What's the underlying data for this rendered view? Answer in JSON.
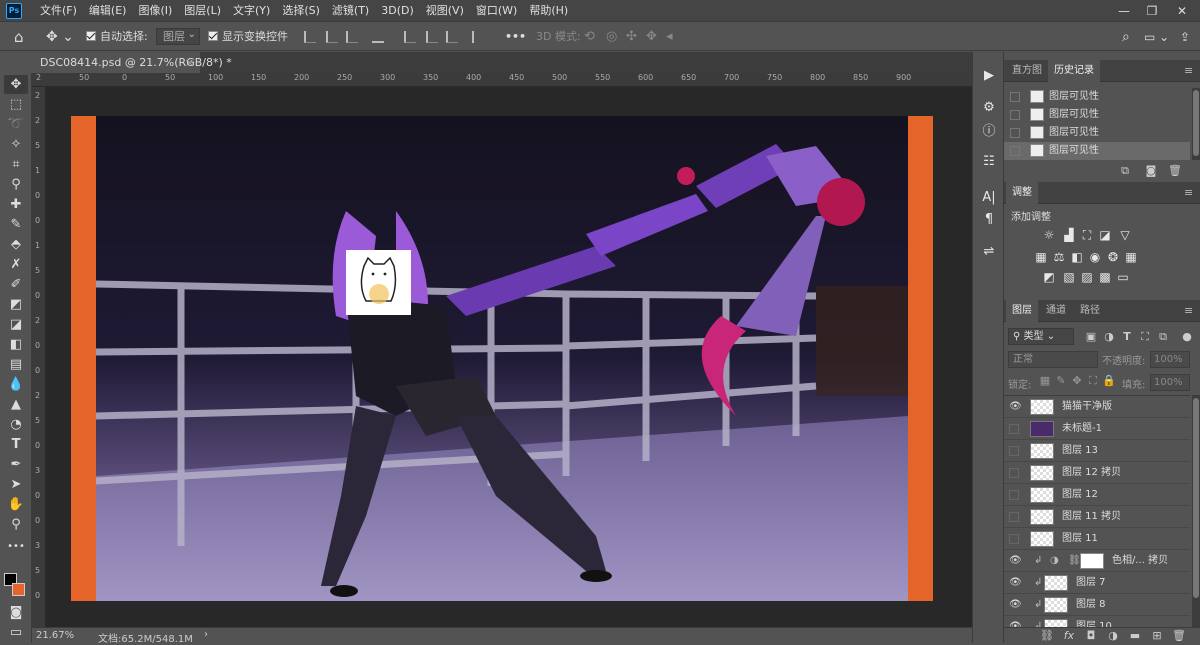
{
  "menubar": {
    "logo": "Ps",
    "items": [
      "文件(F)",
      "编辑(E)",
      "图像(I)",
      "图层(L)",
      "文字(Y)",
      "选择(S)",
      "滤镜(T)",
      "3D(D)",
      "视图(V)",
      "窗口(W)",
      "帮助(H)"
    ],
    "win_min": "—",
    "win_restore": "❐",
    "win_close": "✕"
  },
  "options": {
    "auto_select_label": "自动选择:",
    "auto_select_value": "图层",
    "show_transform_label": "显示变换控件",
    "more": "•••",
    "mode3d_label": "3D 模式:"
  },
  "tab": {
    "title": "DSC08414.psd @ 21.7%(RGB/8*) *",
    "close": "×"
  },
  "ruler_h": [
    "2",
    "50",
    "0",
    "50",
    "100",
    "150",
    "200",
    "250",
    "300",
    "350",
    "400",
    "450",
    "500",
    "550",
    "600",
    "650",
    "700",
    "750",
    "800",
    "850",
    "900"
  ],
  "ruler_v": [
    "2",
    "2",
    "5",
    "1",
    "0",
    "0",
    "1",
    "5",
    "0",
    "2",
    "0",
    "0",
    "2",
    "5",
    "0",
    "3",
    "0",
    "0",
    "3",
    "5",
    "0"
  ],
  "status": {
    "zoom": "21.67%",
    "doc": "文档:65.2M/548.1M",
    "arrow": "›"
  },
  "history": {
    "tabs": [
      "直方图",
      "历史记录"
    ],
    "items": [
      "图层可见性",
      "图层可见性",
      "图层可见性",
      "图层可见性"
    ]
  },
  "adjust": {
    "title": "调整",
    "add_label": "添加调整"
  },
  "layers": {
    "tabs": [
      "图层",
      "通道",
      "路径"
    ],
    "filter_kind": "类型",
    "blend_mode": "正常",
    "opacity_label": "不透明度:",
    "opacity_value": "100%",
    "lock_label": "锁定:",
    "fill_label": "填充:",
    "fill_value": "100%",
    "items": [
      {
        "name": "猫猫干净版",
        "visible": true
      },
      {
        "name": "未标题-1",
        "visible": false
      },
      {
        "name": "图层 13",
        "visible": false
      },
      {
        "name": "图层 12 拷贝",
        "visible": false
      },
      {
        "name": "图层 12",
        "visible": false
      },
      {
        "name": "图层 11 拷贝",
        "visible": false
      },
      {
        "name": "图层 11",
        "visible": false
      },
      {
        "name": "色相/... 拷贝",
        "visible": true
      },
      {
        "name": "图层 7",
        "visible": true
      },
      {
        "name": "图层 8",
        "visible": true
      },
      {
        "name": "图层 10",
        "visible": true
      }
    ]
  }
}
